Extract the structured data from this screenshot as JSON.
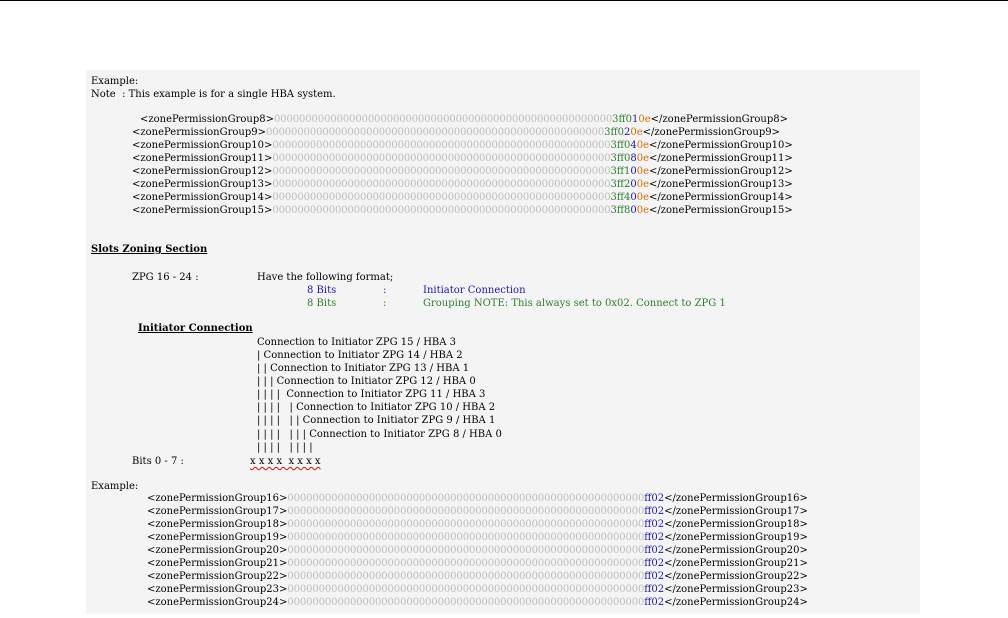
{
  "header": {
    "example_label": "Example:",
    "note_line": "Note  : This example is for a single HBA system."
  },
  "group1": {
    "rows": [
      {
        "open": "<zonePermissionGroup8>",
        "pad": "000000000000000000000000000000000000000000000000000000",
        "p1": "3ff0",
        "p2": "1",
        "p3": "0e",
        "close": "</zonePermissionGroup8>"
      },
      {
        "open": "<zonePermissionGroup9>",
        "pad": "000000000000000000000000000000000000000000000000000000",
        "p1": "3ff0",
        "p2": "2",
        "p3": "0e",
        "close": "</zonePermissionGroup9>"
      },
      {
        "open": "<zonePermissionGroup10>",
        "pad": "000000000000000000000000000000000000000000000000000000",
        "p1": "3ff0",
        "p2": "4",
        "p3": "0e",
        "close": "</zonePermissionGroup10>"
      },
      {
        "open": "<zonePermissionGroup11>",
        "pad": "000000000000000000000000000000000000000000000000000000",
        "p1": "3ff0",
        "p2": "8",
        "p3": "0e",
        "close": "</zonePermissionGroup11>"
      },
      {
        "open": "<zonePermissionGroup12>",
        "pad": "000000000000000000000000000000000000000000000000000000",
        "p1": "3ff1",
        "p2": "0",
        "p3": "0e",
        "close": "</zonePermissionGroup12>"
      },
      {
        "open": "<zonePermissionGroup13>",
        "pad": "000000000000000000000000000000000000000000000000000000",
        "p1": "3ff2",
        "p2": "0",
        "p3": "0e",
        "close": "</zonePermissionGroup13>"
      },
      {
        "open": "<zonePermissionGroup14>",
        "pad": "000000000000000000000000000000000000000000000000000000",
        "p1": "3ff4",
        "p2": "0",
        "p3": "0e",
        "close": "</zonePermissionGroup14>"
      },
      {
        "open": "<zonePermissionGroup15>",
        "pad": "000000000000000000000000000000000000000000000000000000",
        "p1": "3ff8",
        "p2": "0",
        "p3": "0e",
        "close": "</zonePermissionGroup15>"
      }
    ]
  },
  "slots": {
    "heading": "Slots Zoning Section",
    "zpg_label": "ZPG 16 - 24 :",
    "format_text": "Have the following format;",
    "bits_a": "8 Bits",
    "colon_a": ":",
    "desc_a": "Initiator Connection",
    "bits_b": "8 Bits",
    "colon_b": ":",
    "desc_b": "Grouping NOTE: This always set to 0x02. Connect to ZPG 1"
  },
  "initiator": {
    "heading": "Initiator Connection",
    "tree": [
      "Connection to Initiator ZPG 15 / HBA 3",
      "| Connection to Initiator ZPG 14 / HBA 2",
      "| | Connection to Initiator ZPG 13 / HBA 1",
      "| | | Connection to Initiator ZPG 12 / HBA 0",
      "| | | |  Connection to Initiator ZPG 11 / HBA 3",
      "| | | |   | Connection to Initiator ZPG 10 / HBA 2",
      "| | | |   | | Connection to Initiator ZPG 9 / HBA 1",
      "| | | |   | | | Connection to Initiator ZPG 8 / HBA 0",
      "| | | |   | | | |"
    ],
    "bits_label": "Bits 0 - 7 :",
    "bits_value": "x x x x  x x x x"
  },
  "example2": {
    "label": "Example:",
    "rows": [
      {
        "open": "<zonePermissionGroup16>",
        "pad": "000000000000000000000000000000000000000000000000000000000",
        "val": "ff02",
        "close": "</zonePermissionGroup16>"
      },
      {
        "open": "<zonePermissionGroup17>",
        "pad": "000000000000000000000000000000000000000000000000000000000",
        "val": "ff02",
        "close": "</zonePermissionGroup17>"
      },
      {
        "open": "<zonePermissionGroup18>",
        "pad": "000000000000000000000000000000000000000000000000000000000",
        "val": "ff02",
        "close": "</zonePermissionGroup18>"
      },
      {
        "open": "<zonePermissionGroup19>",
        "pad": "000000000000000000000000000000000000000000000000000000000",
        "val": "ff02",
        "close": "</zonePermissionGroup19>"
      },
      {
        "open": "<zonePermissionGroup20>",
        "pad": "000000000000000000000000000000000000000000000000000000000",
        "val": "ff02",
        "close": "</zonePermissionGroup20>"
      },
      {
        "open": "<zonePermissionGroup21>",
        "pad": "000000000000000000000000000000000000000000000000000000000",
        "val": "ff02",
        "close": "</zonePermissionGroup21>"
      },
      {
        "open": "<zonePermissionGroup22>",
        "pad": "000000000000000000000000000000000000000000000000000000000",
        "val": "ff02",
        "close": "</zonePermissionGroup22>"
      },
      {
        "open": "<zonePermissionGroup23>",
        "pad": "000000000000000000000000000000000000000000000000000000000",
        "val": "ff02",
        "close": "</zonePermissionGroup23>"
      },
      {
        "open": "<zonePermissionGroup24>",
        "pad": "000000000000000000000000000000000000000000000000000000000",
        "val": "ff02",
        "close": "</zonePermissionGroup24>"
      }
    ]
  },
  "colors": {
    "green": "#2d7f2d",
    "blue": "#1a1aa8",
    "orange": "#d96a00",
    "pad_gray": "#bcbcbc"
  }
}
